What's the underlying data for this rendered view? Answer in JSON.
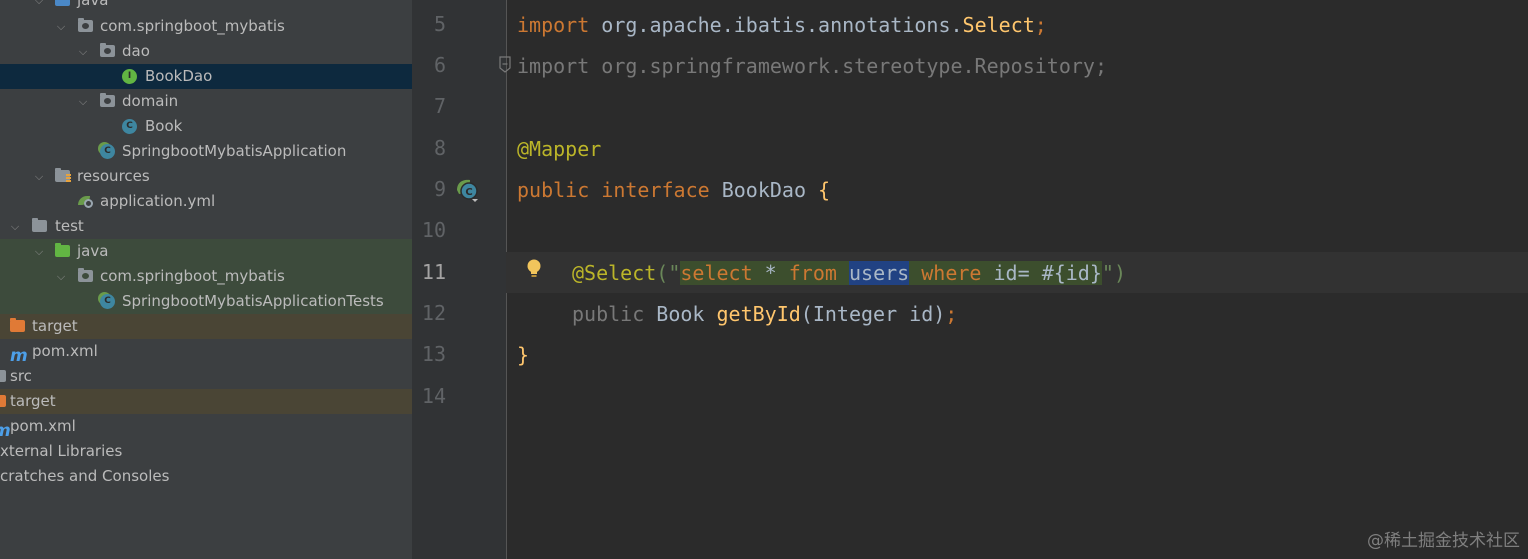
{
  "project_tree": {
    "items": [
      {
        "label": "java",
        "type": "source-folder"
      },
      {
        "label": "com.springboot_mybatis",
        "type": "package"
      },
      {
        "label": "dao",
        "type": "package"
      },
      {
        "label": "BookDao",
        "type": "interface",
        "selected": true
      },
      {
        "label": "domain",
        "type": "package"
      },
      {
        "label": "Book",
        "type": "class"
      },
      {
        "label": "SpringbootMybatisApplication",
        "type": "spring-class"
      },
      {
        "label": "resources",
        "type": "resources-folder"
      },
      {
        "label": "application.yml",
        "type": "yml-file"
      },
      {
        "label": "test",
        "type": "folder"
      },
      {
        "label": "java",
        "type": "test-source-folder"
      },
      {
        "label": "com.springboot_mybatis",
        "type": "package"
      },
      {
        "label": "SpringbootMybatisApplicationTests",
        "type": "spring-class"
      },
      {
        "label": "target",
        "type": "excluded-folder"
      },
      {
        "label": "pom.xml",
        "type": "maven-file"
      },
      {
        "label": "src",
        "type": "folder"
      },
      {
        "label": "target",
        "type": "excluded-folder"
      },
      {
        "label": "pom.xml",
        "type": "maven-file"
      },
      {
        "label": "xternal Libraries",
        "type": "libraries"
      },
      {
        "label": "cratches and Consoles",
        "type": "scratches"
      }
    ]
  },
  "editor": {
    "line_numbers": [
      "5",
      "6",
      "7",
      "8",
      "9",
      "10",
      "11",
      "12",
      "13",
      "14"
    ],
    "current_line": "11",
    "lines": {
      "l5": {
        "kw": "import",
        "pkg": " org.apache.ibatis.annotations.",
        "cls": "Select",
        "semi": ";"
      },
      "l6": {
        "text": "import org.springframework.stereotype.Repository;"
      },
      "l8": {
        "ann": "@Mapper"
      },
      "l9": {
        "kw1": "public",
        "kw2": " interface ",
        "name": "BookDao",
        "brace": " {"
      },
      "l11": {
        "ann": "@Select",
        "open": "(\"",
        "s1": "select",
        "s2": " * ",
        "s3": "from",
        "s4": " ",
        "s5": "users",
        "s6": " ",
        "s7": "where",
        "s8": " id= ",
        "s9": "#{id}",
        "close": "\")"
      },
      "l12": {
        "kw": "public",
        "type": " Book ",
        "method": "getById",
        "args": "(Integer id)",
        "semi": ";"
      },
      "l13": {
        "brace": "}"
      }
    }
  },
  "watermark": "@稀土掘金技术社区",
  "colors": {
    "tree_bg": "#3c3f41",
    "editor_bg": "#2b2b2b",
    "keyword": "#cc7832",
    "annotation": "#bbb529",
    "selection": "#214283"
  }
}
